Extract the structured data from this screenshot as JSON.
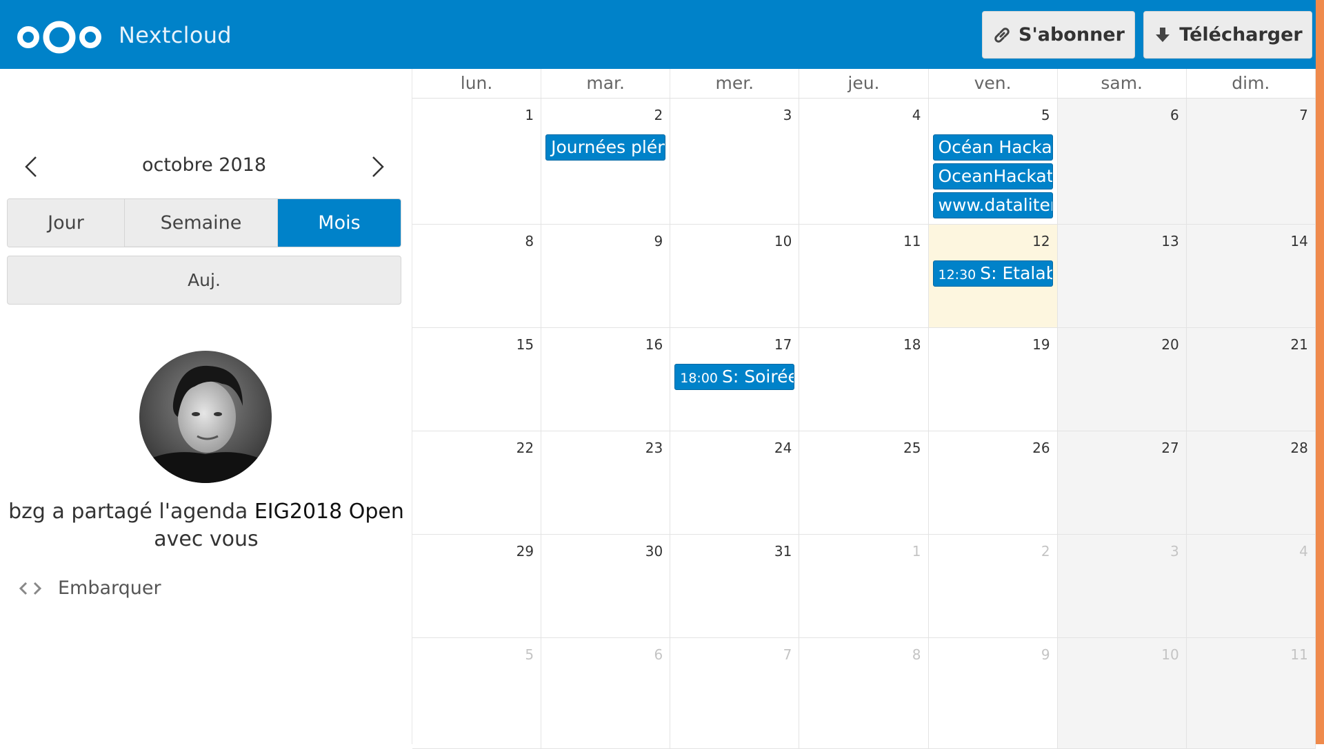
{
  "header": {
    "app_name": "Nextcloud",
    "subscribe_label": "S'abonner",
    "download_label": "Télécharger",
    "colors": {
      "brand": "#0082c9",
      "accent_edge": "#ef8a4c"
    }
  },
  "sidebar": {
    "month_label": "octobre 2018",
    "views": {
      "day": "Jour",
      "week": "Semaine",
      "month": "Mois",
      "active": "month"
    },
    "today_label": "Auj.",
    "shared_prefix": "bzg a partagé l'agenda ",
    "shared_calendar": "EIG2018 Open",
    "shared_suffix": "avec vous",
    "embed_label": "Embarquer"
  },
  "calendar": {
    "weekdays": [
      "lun.",
      "mar.",
      "mer.",
      "jeu.",
      "ven.",
      "sam.",
      "dim."
    ],
    "weeks": [
      {
        "days": [
          {
            "num": "1"
          },
          {
            "num": "2",
            "events": [
              {
                "title": "Journées plénières"
              }
            ]
          },
          {
            "num": "3"
          },
          {
            "num": "4"
          },
          {
            "num": "5",
            "events": [
              {
                "title": "Océan Hackathon"
              },
              {
                "title": "OceanHackathon"
              },
              {
                "title": "www.dataliteracy"
              }
            ]
          },
          {
            "num": "6",
            "weekend": true
          },
          {
            "num": "7",
            "weekend": true
          }
        ]
      },
      {
        "days": [
          {
            "num": "8"
          },
          {
            "num": "9"
          },
          {
            "num": "10"
          },
          {
            "num": "11"
          },
          {
            "num": "12",
            "today": true,
            "events": [
              {
                "time": "12:30",
                "title": "S: Etalab"
              }
            ]
          },
          {
            "num": "13",
            "weekend": true
          },
          {
            "num": "14",
            "weekend": true
          }
        ]
      },
      {
        "days": [
          {
            "num": "15"
          },
          {
            "num": "16"
          },
          {
            "num": "17",
            "events": [
              {
                "time": "18:00",
                "title": "S: Soirée"
              }
            ]
          },
          {
            "num": "18"
          },
          {
            "num": "19"
          },
          {
            "num": "20",
            "weekend": true
          },
          {
            "num": "21",
            "weekend": true
          }
        ]
      },
      {
        "days": [
          {
            "num": "22"
          },
          {
            "num": "23"
          },
          {
            "num": "24"
          },
          {
            "num": "25"
          },
          {
            "num": "26"
          },
          {
            "num": "27",
            "weekend": true
          },
          {
            "num": "28",
            "weekend": true
          }
        ]
      },
      {
        "days": [
          {
            "num": "29"
          },
          {
            "num": "30"
          },
          {
            "num": "31"
          },
          {
            "num": "1",
            "other": true
          },
          {
            "num": "2",
            "other": true
          },
          {
            "num": "3",
            "other": true,
            "weekend": true
          },
          {
            "num": "4",
            "other": true,
            "weekend": true
          }
        ]
      },
      {
        "days": [
          {
            "num": "5",
            "other": true
          },
          {
            "num": "6",
            "other": true
          },
          {
            "num": "7",
            "other": true
          },
          {
            "num": "8",
            "other": true
          },
          {
            "num": "9",
            "other": true
          },
          {
            "num": "10",
            "other": true,
            "weekend": true
          },
          {
            "num": "11",
            "other": true,
            "weekend": true
          }
        ]
      }
    ]
  },
  "icons": {
    "logo": "nextcloud-logo",
    "subscribe": "link-icon",
    "download": "download-arrow-icon",
    "prev": "chevron-left-icon",
    "next": "chevron-right-icon",
    "embed": "code-brackets-icon"
  }
}
